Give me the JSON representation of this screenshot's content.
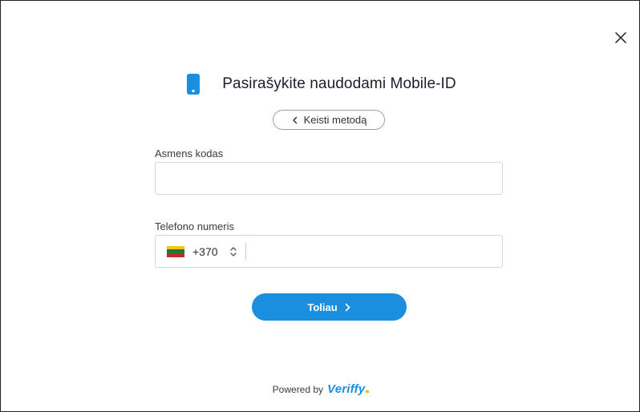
{
  "dialog": {
    "close_icon": "close-icon",
    "title": "Pasirašykite naudodami Mobile-ID",
    "title_icon": "mobile-phone-icon",
    "change_method_label": "Keisti metodą"
  },
  "form": {
    "personal_code": {
      "label": "Asmens kodas",
      "value": "",
      "placeholder": ""
    },
    "phone": {
      "label": "Telefono numeris",
      "country_flag": "lithuania-flag-icon",
      "dial_code": "+370",
      "value": "",
      "placeholder": ""
    },
    "submit_label": "Toliau"
  },
  "footer": {
    "powered_by": "Powered by",
    "brand": "Veriffy"
  },
  "colors": {
    "accent": "#1a8fdf",
    "flag_yellow": "#f7c51e",
    "flag_green": "#1f7a3a",
    "flag_red": "#c42a2a"
  }
}
